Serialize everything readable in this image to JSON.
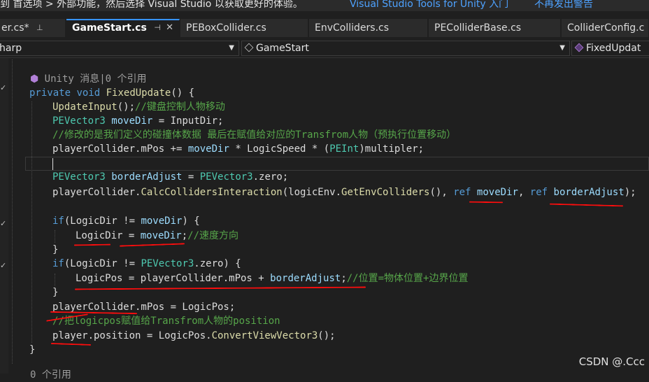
{
  "banner": {
    "message": "转到 首选项 > 外部功能，然后选择 Visual Studio 以获取更好的体验。",
    "link_install": "Visual Studio Tools for Unity 入门",
    "link_dismiss": "不再发出警告"
  },
  "tabs": [
    {
      "label": "er.cs*",
      "pin_icon": "⊥"
    },
    {
      "label": "GameStart.cs",
      "pin_icon": "⊣",
      "close_icon": "✕",
      "active": true
    },
    {
      "label": "PEBoxCollider.cs"
    },
    {
      "label": "EnvColliders.cs"
    },
    {
      "label": "PEColliderBase.cs"
    },
    {
      "label": "ColliderConfig.c"
    }
  ],
  "navbar": {
    "project": "harp",
    "class_name": "GameStart",
    "member": "FixedUpdat"
  },
  "code": {
    "codelens": "Unity 消息|0 个引用",
    "method_sig": [
      "private",
      "void",
      "FixedUpdate",
      "() {"
    ],
    "comment_update_input": "//键盘控制人物移动",
    "comment_modify": "//修改的是我们定义的碰撞体数据 最后在赋值给对应的Transfrom人物（预执行位置移动）",
    "comment_speed": "//速度方向",
    "comment_pos": "//位置=物体位置+边界位置",
    "comment_assign": "//把logicpos赋值给Transfrom人物的position",
    "next_lens": "0 个引用"
  },
  "watermark": "CSDN @.Ccc",
  "colors": {
    "background": "#1f1f1f",
    "keyword": "#569cd6",
    "type": "#4ec9b0",
    "method": "#dcdcaa",
    "variable": "#9cdcfe",
    "comment": "#57a64a",
    "annotation": "#ff0d0d",
    "accent": "#3794ff"
  }
}
